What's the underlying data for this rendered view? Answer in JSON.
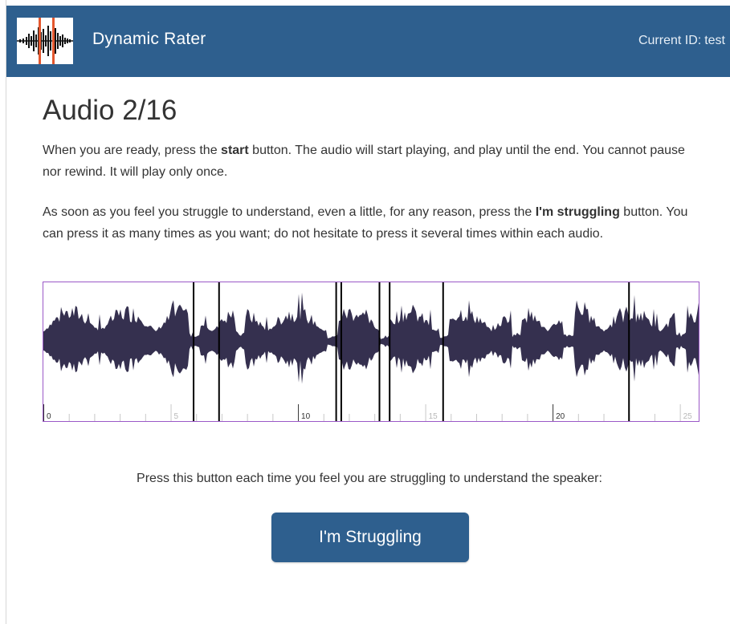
{
  "header": {
    "app_name": "Dynamic Rater",
    "current_id_label": "Current ID:",
    "current_id_value": "test",
    "logo_icon": "waveform-logo-icon"
  },
  "main": {
    "title": "Audio 2/16",
    "para1": [
      {
        "text": "When you are ready, press the "
      },
      {
        "text": "start",
        "bold": true
      },
      {
        "text": " button. The audio will start playing, and play until the end. You cannot pause nor rewind. It will play only once."
      }
    ],
    "para2": [
      {
        "text": "As soon as you feel you struggle to understand, even a little, for any reason, press the "
      },
      {
        "text": "I'm struggling",
        "bold": true
      },
      {
        "text": " button. You can press it as many times as you want; do not hesitate to press it several times within each audio."
      }
    ]
  },
  "waveform": {
    "duration_seconds": 25.8,
    "ticks": [
      {
        "value": 0,
        "label": "0",
        "major": true
      },
      {
        "value": 5,
        "label": "5",
        "major": false
      },
      {
        "value": 10,
        "label": "10",
        "major": true
      },
      {
        "value": 15,
        "label": "15",
        "major": false
      },
      {
        "value": 20,
        "label": "20",
        "major": true
      },
      {
        "value": 25,
        "label": "25",
        "major": false
      }
    ],
    "marker_times": [
      5.9,
      6.9,
      11.5,
      11.7,
      13.2,
      13.6,
      15.7,
      23.0
    ],
    "colors": {
      "wave": "#35304f",
      "marker": "#000000",
      "border": "#9b59c7",
      "tick": "#c8c8c8",
      "major_label": "#333333",
      "minor_label": "#b8b8b8"
    }
  },
  "instruction": "Press this button each time you feel you are struggling to understand the speaker:",
  "button": {
    "label": "I'm Struggling"
  },
  "colors": {
    "brand": "#2e5f8e"
  }
}
